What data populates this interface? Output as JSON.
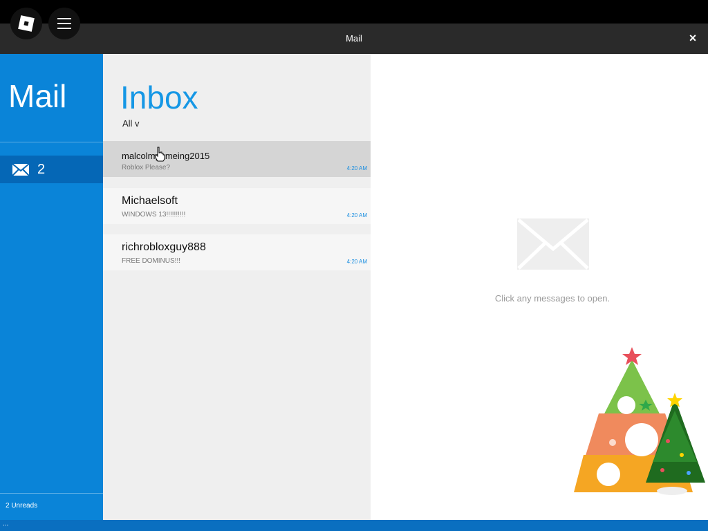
{
  "window": {
    "title": "Mail",
    "close_label": "×"
  },
  "sidebar": {
    "title": "Mail",
    "folder_count": "2",
    "unreads_label": "2 Unreads"
  },
  "inbox": {
    "title": "Inbox",
    "filter_label": "All  v",
    "messages": [
      {
        "from": "malcolmgameing2015",
        "subject": "Roblox Please?",
        "time": "4:20 AM"
      },
      {
        "from": "Michaelsoft",
        "subject": "WINDOWS 13!!!!!!!!!!",
        "time": "4:20 AM"
      },
      {
        "from": "richrobloxguy888",
        "subject": "FREE DOMINUS!!!",
        "time": "4:20 AM"
      }
    ]
  },
  "reading_pane": {
    "hint": "Click any messages to open."
  },
  "bottom": {
    "text": "..."
  },
  "colors": {
    "sidebar": "#0a84d8",
    "accent": "#1597e5",
    "titlebar": "#2a2a2a"
  },
  "icons": [
    "roblox-logo-icon",
    "menu-icon",
    "close-icon",
    "envelope-icon",
    "cursor-hand-icon",
    "christmas-tree-icon"
  ]
}
